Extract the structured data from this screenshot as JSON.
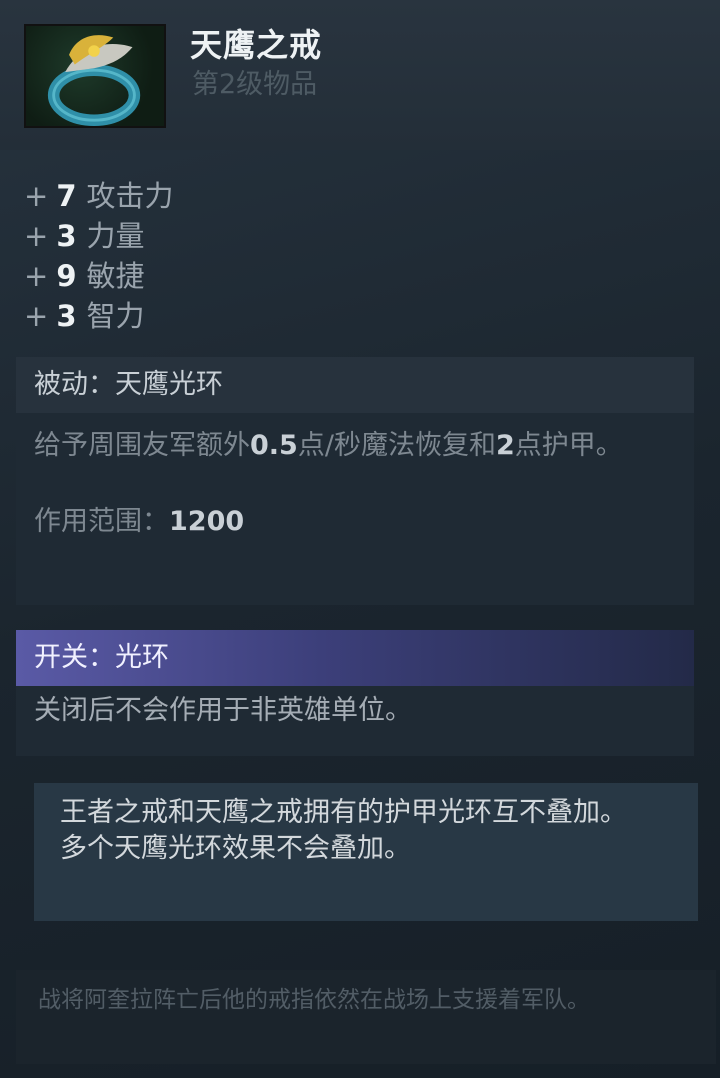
{
  "item": {
    "name": "天鹰之戒",
    "level": "第2级物品"
  },
  "stats": [
    {
      "sign": "+",
      "value": "7",
      "label": "攻击力"
    },
    {
      "sign": "+",
      "value": "3",
      "label": "力量"
    },
    {
      "sign": "+",
      "value": "9",
      "label": "敏捷"
    },
    {
      "sign": "+",
      "value": "3",
      "label": "智力"
    }
  ],
  "passive": {
    "header": "被动：天鹰光环",
    "desc_part1": "给予周围友军额外",
    "desc_mana": "0.5",
    "desc_part2": "点/秒魔法恢复和",
    "desc_armor": "2",
    "desc_part3": "点护甲。",
    "range_label": "作用范围：",
    "range_value": "1200"
  },
  "toggle": {
    "header": "开关：光环",
    "desc": "关闭后不会作用于非英雄单位。"
  },
  "notes": {
    "line1": "王者之戒和天鹰之戒拥有的护甲光环互不叠加。",
    "line2": "多个天鹰光环效果不会叠加。"
  },
  "lore": "战将阿奎拉阵亡后他的戒指依然在战场上支援着军队。",
  "colors": {
    "background": "#1a232c",
    "toggle_accent": "#5a5aa6",
    "note_bg": "#283845"
  }
}
